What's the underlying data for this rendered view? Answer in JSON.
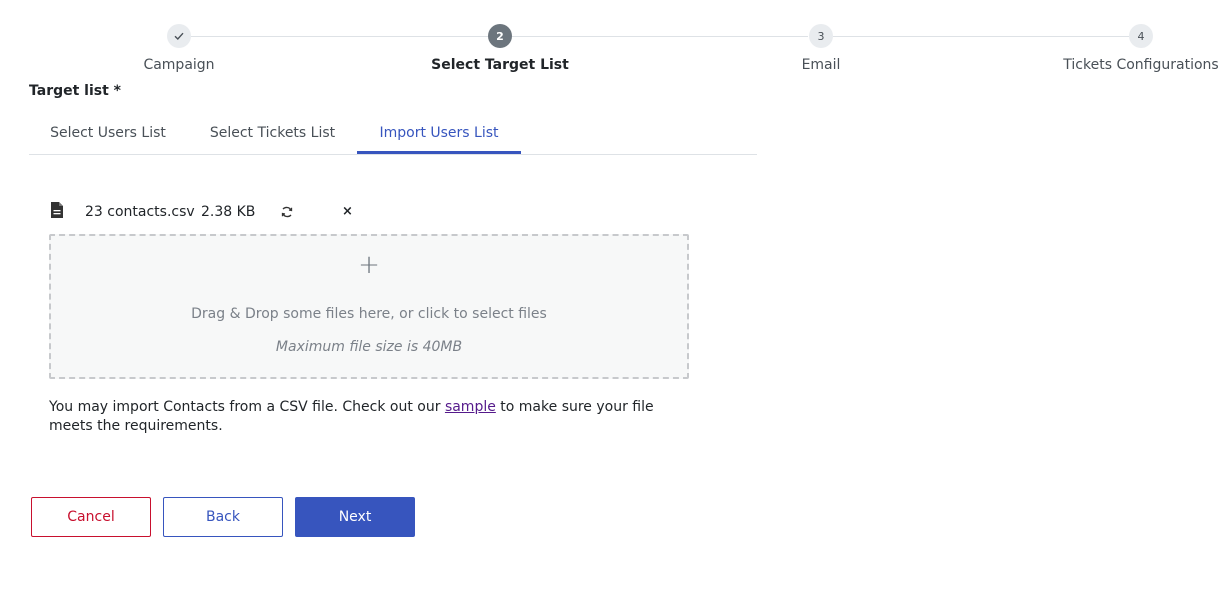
{
  "stepper": {
    "steps": [
      {
        "number": "",
        "label": "Campaign",
        "state": "completed",
        "icon": "check-icon"
      },
      {
        "number": "2",
        "label": "Select Target List",
        "state": "active"
      },
      {
        "number": "3",
        "label": "Email",
        "state": "pending"
      },
      {
        "number": "4",
        "label": "Tickets Configurations",
        "state": "pending"
      }
    ]
  },
  "target_list": {
    "label": "Target list *",
    "tabs": [
      {
        "label": "Select Users List",
        "active": false
      },
      {
        "label": "Select Tickets List",
        "active": false
      },
      {
        "label": "Import Users List",
        "active": true
      }
    ]
  },
  "file": {
    "icon": "file-icon",
    "name": "23 contacts.csv",
    "size": "2.38 KB",
    "reload_icon": "reload-icon",
    "remove_icon": "close-icon",
    "remove_glyph": "×"
  },
  "dropzone": {
    "plus_glyph": "+",
    "text": "Drag & Drop some files here, or click to select files",
    "hint": "Maximum file size is 40MB"
  },
  "help": {
    "before": "You may import Contacts from a CSV file. Check out our ",
    "link": "sample",
    "after": " to make sure your file meets the requirements."
  },
  "buttons": {
    "cancel": "Cancel",
    "back": "Back",
    "next": "Next"
  },
  "colors": {
    "primary": "#3755be",
    "danger": "#c8102e",
    "step_active": "#6c757d"
  }
}
